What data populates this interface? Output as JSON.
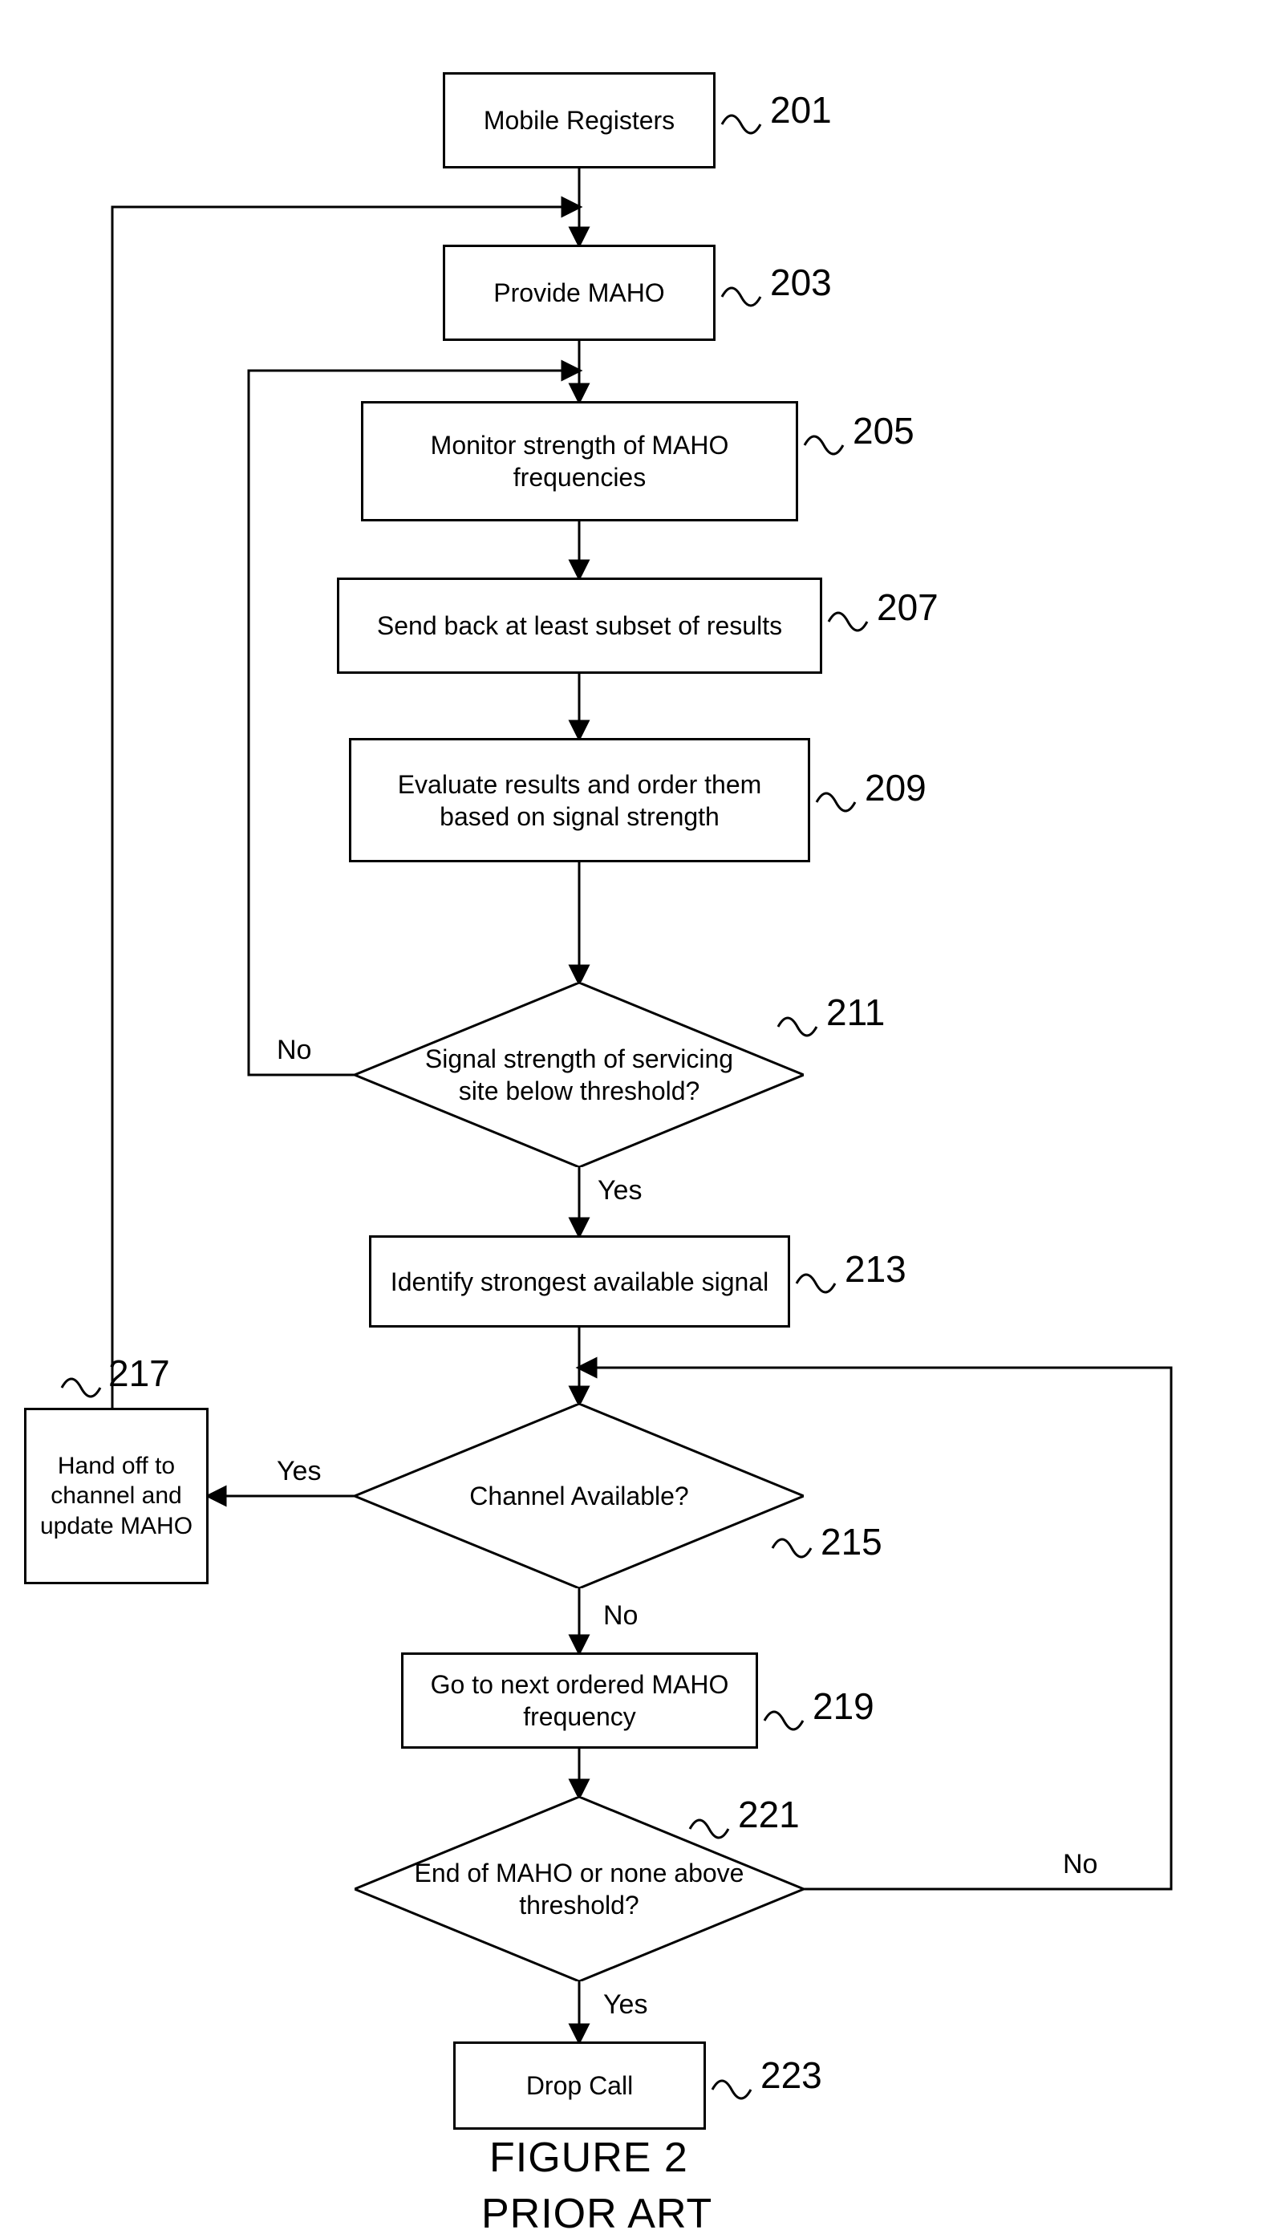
{
  "nodes": {
    "n201": "Mobile Registers",
    "n203": "Provide MAHO",
    "n205": "Monitor strength of MAHO frequencies",
    "n207": "Send back at least subset of results",
    "n209": "Evaluate results and order them based on signal strength",
    "n211": "Signal strength of servicing site below threshold?",
    "n213": "Identify strongest available signal",
    "n215": "Channel Available?",
    "n217": "Hand off to channel and update MAHO",
    "n219": "Go to next ordered MAHO frequency",
    "n221": "End of MAHO or none above threshold?",
    "n223": "Drop Call"
  },
  "refs": {
    "r201": "201",
    "r203": "203",
    "r205": "205",
    "r207": "207",
    "r209": "209",
    "r211": "211",
    "r213": "213",
    "r215": "215",
    "r217": "217",
    "r219": "219",
    "r221": "221",
    "r223": "223"
  },
  "labels": {
    "yes": "Yes",
    "no": "No"
  },
  "caption": {
    "fig": "FIGURE 2",
    "sub": "PRIOR ART"
  }
}
